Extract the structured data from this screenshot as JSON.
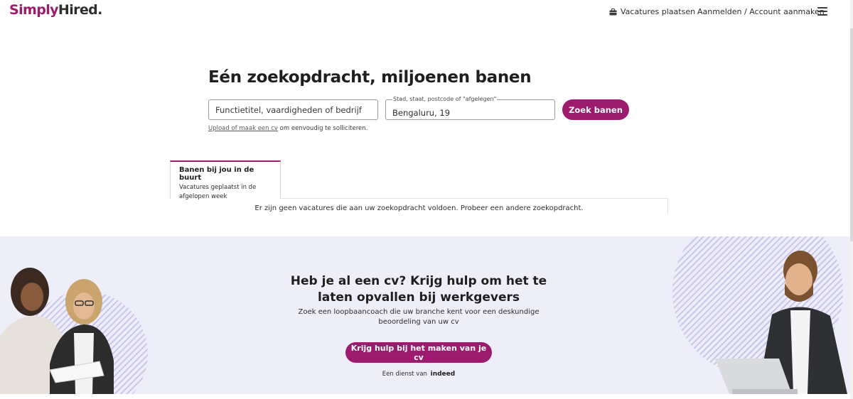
{
  "header": {
    "logo_simply": "Simply",
    "logo_hired": "Hired.",
    "post_jobs": "Vacatures plaatsen",
    "login": "Aanmelden / Account aanmaken",
    "menu_icon": "hamburger-menu-icon",
    "post_icon": "briefcase-icon"
  },
  "search": {
    "title": "Eén zoekopdracht, miljoenen banen",
    "what_placeholder": "Functietitel, vaardigheden of bedrijf",
    "where_label": "Stad, staat, postcode of \"afgelegen\"",
    "where_value": "Bengaluru, 19",
    "button": "Zoek banen",
    "upload_link": "Upload of maak een cv",
    "upload_text": " om eenvoudig te solliciteren."
  },
  "tabs": {
    "active_title": "Banen bij jou in de buurt",
    "active_subtitle": "Vacatures geplaatst in de afgelopen week",
    "empty_message": "Er zijn geen vacatures die aan uw zoekopdracht voldoen. Probeer een andere zoekopdracht."
  },
  "promo": {
    "title": "Heb je al een cv? Krijg hulp om het te laten opvallen bij werkgevers",
    "subtitle": "Zoek een loopbaancoach die uw branche kent voor een deskundige beoordeling van uw cv",
    "button": "Krijg hulp bij het maken van je cv",
    "footer_prefix": "Een dienst van",
    "footer_brand": "indeed"
  },
  "colors": {
    "brand": "#9c1b6e",
    "promo_bg": "#eeeef8",
    "stripe": "#c9c4ee"
  }
}
